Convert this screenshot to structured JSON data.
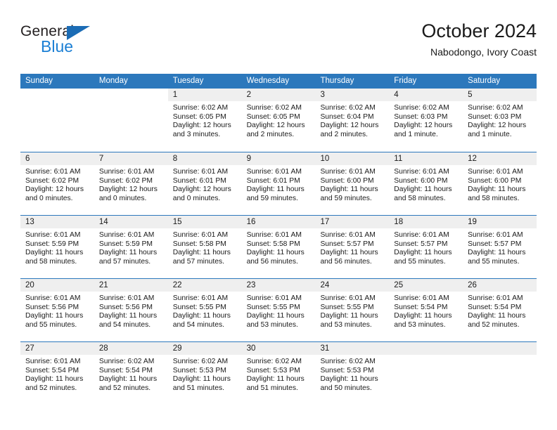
{
  "brand": {
    "name_part1": "General",
    "name_part2": "Blue",
    "accent_color": "#1b7fd4",
    "triangle_color": "#1b6cb5"
  },
  "header": {
    "title": "October 2024",
    "location": "Nabodongo, Ivory Coast"
  },
  "theme": {
    "header_blue": "#2c78bc",
    "day_band_gray": "#efefef",
    "text": "#1a1a1a"
  },
  "weekdays": [
    "Sunday",
    "Monday",
    "Tuesday",
    "Wednesday",
    "Thursday",
    "Friday",
    "Saturday"
  ],
  "weeks": [
    [
      {
        "day": "",
        "lines": []
      },
      {
        "day": "",
        "lines": []
      },
      {
        "day": "1",
        "lines": [
          "Sunrise: 6:02 AM",
          "Sunset: 6:05 PM",
          "Daylight: 12 hours",
          "and 3 minutes."
        ]
      },
      {
        "day": "2",
        "lines": [
          "Sunrise: 6:02 AM",
          "Sunset: 6:05 PM",
          "Daylight: 12 hours",
          "and 2 minutes."
        ]
      },
      {
        "day": "3",
        "lines": [
          "Sunrise: 6:02 AM",
          "Sunset: 6:04 PM",
          "Daylight: 12 hours",
          "and 2 minutes."
        ]
      },
      {
        "day": "4",
        "lines": [
          "Sunrise: 6:02 AM",
          "Sunset: 6:03 PM",
          "Daylight: 12 hours",
          "and 1 minute."
        ]
      },
      {
        "day": "5",
        "lines": [
          "Sunrise: 6:02 AM",
          "Sunset: 6:03 PM",
          "Daylight: 12 hours",
          "and 1 minute."
        ]
      }
    ],
    [
      {
        "day": "6",
        "lines": [
          "Sunrise: 6:01 AM",
          "Sunset: 6:02 PM",
          "Daylight: 12 hours",
          "and 0 minutes."
        ]
      },
      {
        "day": "7",
        "lines": [
          "Sunrise: 6:01 AM",
          "Sunset: 6:02 PM",
          "Daylight: 12 hours",
          "and 0 minutes."
        ]
      },
      {
        "day": "8",
        "lines": [
          "Sunrise: 6:01 AM",
          "Sunset: 6:01 PM",
          "Daylight: 12 hours",
          "and 0 minutes."
        ]
      },
      {
        "day": "9",
        "lines": [
          "Sunrise: 6:01 AM",
          "Sunset: 6:01 PM",
          "Daylight: 11 hours",
          "and 59 minutes."
        ]
      },
      {
        "day": "10",
        "lines": [
          "Sunrise: 6:01 AM",
          "Sunset: 6:00 PM",
          "Daylight: 11 hours",
          "and 59 minutes."
        ]
      },
      {
        "day": "11",
        "lines": [
          "Sunrise: 6:01 AM",
          "Sunset: 6:00 PM",
          "Daylight: 11 hours",
          "and 58 minutes."
        ]
      },
      {
        "day": "12",
        "lines": [
          "Sunrise: 6:01 AM",
          "Sunset: 6:00 PM",
          "Daylight: 11 hours",
          "and 58 minutes."
        ]
      }
    ],
    [
      {
        "day": "13",
        "lines": [
          "Sunrise: 6:01 AM",
          "Sunset: 5:59 PM",
          "Daylight: 11 hours",
          "and 58 minutes."
        ]
      },
      {
        "day": "14",
        "lines": [
          "Sunrise: 6:01 AM",
          "Sunset: 5:59 PM",
          "Daylight: 11 hours",
          "and 57 minutes."
        ]
      },
      {
        "day": "15",
        "lines": [
          "Sunrise: 6:01 AM",
          "Sunset: 5:58 PM",
          "Daylight: 11 hours",
          "and 57 minutes."
        ]
      },
      {
        "day": "16",
        "lines": [
          "Sunrise: 6:01 AM",
          "Sunset: 5:58 PM",
          "Daylight: 11 hours",
          "and 56 minutes."
        ]
      },
      {
        "day": "17",
        "lines": [
          "Sunrise: 6:01 AM",
          "Sunset: 5:57 PM",
          "Daylight: 11 hours",
          "and 56 minutes."
        ]
      },
      {
        "day": "18",
        "lines": [
          "Sunrise: 6:01 AM",
          "Sunset: 5:57 PM",
          "Daylight: 11 hours",
          "and 55 minutes."
        ]
      },
      {
        "day": "19",
        "lines": [
          "Sunrise: 6:01 AM",
          "Sunset: 5:57 PM",
          "Daylight: 11 hours",
          "and 55 minutes."
        ]
      }
    ],
    [
      {
        "day": "20",
        "lines": [
          "Sunrise: 6:01 AM",
          "Sunset: 5:56 PM",
          "Daylight: 11 hours",
          "and 55 minutes."
        ]
      },
      {
        "day": "21",
        "lines": [
          "Sunrise: 6:01 AM",
          "Sunset: 5:56 PM",
          "Daylight: 11 hours",
          "and 54 minutes."
        ]
      },
      {
        "day": "22",
        "lines": [
          "Sunrise: 6:01 AM",
          "Sunset: 5:55 PM",
          "Daylight: 11 hours",
          "and 54 minutes."
        ]
      },
      {
        "day": "23",
        "lines": [
          "Sunrise: 6:01 AM",
          "Sunset: 5:55 PM",
          "Daylight: 11 hours",
          "and 53 minutes."
        ]
      },
      {
        "day": "24",
        "lines": [
          "Sunrise: 6:01 AM",
          "Sunset: 5:55 PM",
          "Daylight: 11 hours",
          "and 53 minutes."
        ]
      },
      {
        "day": "25",
        "lines": [
          "Sunrise: 6:01 AM",
          "Sunset: 5:54 PM",
          "Daylight: 11 hours",
          "and 53 minutes."
        ]
      },
      {
        "day": "26",
        "lines": [
          "Sunrise: 6:01 AM",
          "Sunset: 5:54 PM",
          "Daylight: 11 hours",
          "and 52 minutes."
        ]
      }
    ],
    [
      {
        "day": "27",
        "lines": [
          "Sunrise: 6:01 AM",
          "Sunset: 5:54 PM",
          "Daylight: 11 hours",
          "and 52 minutes."
        ]
      },
      {
        "day": "28",
        "lines": [
          "Sunrise: 6:02 AM",
          "Sunset: 5:54 PM",
          "Daylight: 11 hours",
          "and 52 minutes."
        ]
      },
      {
        "day": "29",
        "lines": [
          "Sunrise: 6:02 AM",
          "Sunset: 5:53 PM",
          "Daylight: 11 hours",
          "and 51 minutes."
        ]
      },
      {
        "day": "30",
        "lines": [
          "Sunrise: 6:02 AM",
          "Sunset: 5:53 PM",
          "Daylight: 11 hours",
          "and 51 minutes."
        ]
      },
      {
        "day": "31",
        "lines": [
          "Sunrise: 6:02 AM",
          "Sunset: 5:53 PM",
          "Daylight: 11 hours",
          "and 50 minutes."
        ]
      },
      {
        "day": "",
        "lines": []
      },
      {
        "day": "",
        "lines": []
      }
    ]
  ]
}
